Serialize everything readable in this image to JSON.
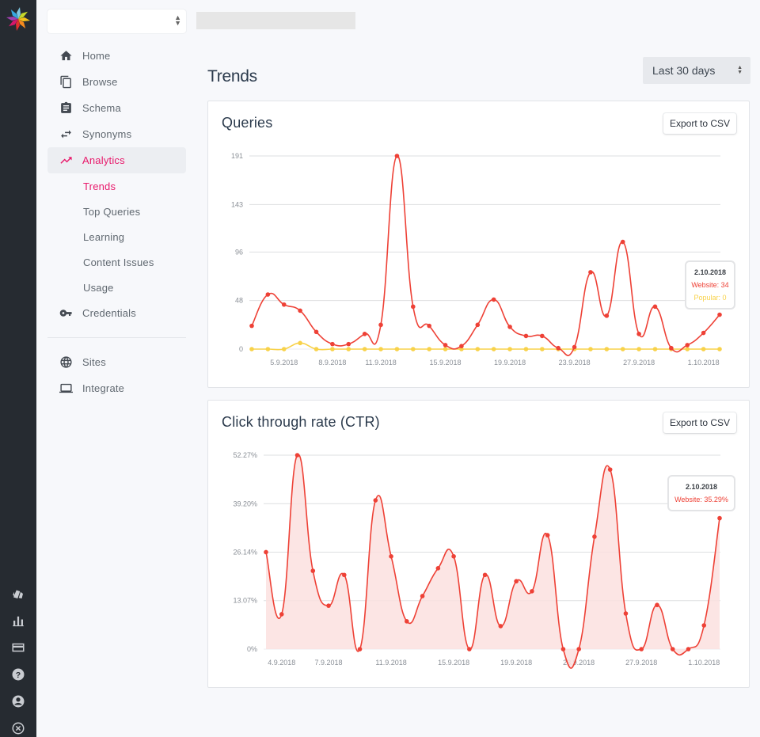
{
  "app": {
    "site_selector_value": "",
    "rail_icons": [
      "cards-icon",
      "bar-chart-icon",
      "credit-card-icon",
      "help-icon",
      "account-icon",
      "close-circle-icon"
    ]
  },
  "sidebar": {
    "items": [
      {
        "label": "Home",
        "icon": "home-icon"
      },
      {
        "label": "Browse",
        "icon": "copy-icon"
      },
      {
        "label": "Schema",
        "icon": "clipboard-icon"
      },
      {
        "label": "Synonyms",
        "icon": "swap-icon"
      },
      {
        "label": "Analytics",
        "icon": "trending-up-icon",
        "active": true
      }
    ],
    "analytics_sub": [
      {
        "label": "Trends",
        "active": true
      },
      {
        "label": "Top Queries"
      },
      {
        "label": "Learning"
      },
      {
        "label": "Content Issues"
      },
      {
        "label": "Usage"
      }
    ],
    "credentials": {
      "label": "Credentials",
      "icon": "key-icon"
    },
    "bottom_items": [
      {
        "label": "Sites",
        "icon": "globe-icon"
      },
      {
        "label": "Integrate",
        "icon": "laptop-icon"
      }
    ]
  },
  "header": {
    "title": "Trends",
    "range_select": "Last 30 days"
  },
  "colors": {
    "accent": "#e8196b",
    "website_series": "#ee4136",
    "popular_series": "#f8d24a",
    "ctr_fill": "#fbe0df"
  },
  "chart_data": [
    {
      "type": "line",
      "title": "Queries",
      "export_label": "Export to CSV",
      "xlabel": "",
      "ylabel": "",
      "yticks": [
        0,
        48,
        96,
        143,
        191
      ],
      "ylim": [
        0,
        191
      ],
      "grid": true,
      "x": [
        "3.9.2018",
        "4.9.2018",
        "5.9.2018",
        "6.9.2018",
        "7.9.2018",
        "8.9.2018",
        "9.9.2018",
        "10.9.2018",
        "11.9.2018",
        "12.9.2018",
        "13.9.2018",
        "14.9.2018",
        "15.9.2018",
        "16.9.2018",
        "17.9.2018",
        "18.9.2018",
        "19.9.2018",
        "20.9.2018",
        "21.9.2018",
        "22.9.2018",
        "23.9.2018",
        "24.9.2018",
        "25.9.2018",
        "26.9.2018",
        "27.9.2018",
        "28.9.2018",
        "29.9.2018",
        "30.9.2018",
        "1.10.2018",
        "2.10.2018"
      ],
      "xtick_labels": [
        "5.9.2018",
        "8.9.2018",
        "11.9.2018",
        "15.9.2018",
        "19.9.2018",
        "23.9.2018",
        "27.9.2018",
        "1.10.2018"
      ],
      "xtick_indices": [
        2,
        5,
        8,
        12,
        16,
        20,
        24,
        28
      ],
      "series": [
        {
          "name": "Website",
          "color": "#ee4136",
          "values": [
            23,
            54,
            44,
            38,
            17,
            5,
            5,
            15,
            24,
            191,
            42,
            23,
            4,
            3,
            24,
            49,
            22,
            13,
            13,
            1,
            2,
            76,
            33,
            106,
            15,
            42,
            1,
            4,
            16,
            34
          ]
        },
        {
          "name": "Popular",
          "color": "#f8d24a",
          "values": [
            0,
            0,
            0,
            6,
            0,
            0,
            0,
            0,
            0,
            0,
            0,
            0,
            0,
            0,
            0,
            0,
            0,
            0,
            0,
            0,
            0,
            0,
            0,
            0,
            0,
            0,
            0,
            0,
            0,
            0
          ]
        }
      ],
      "tooltip": {
        "date": "2.10.2018",
        "lines": [
          "Website: 34",
          "Popular: 0"
        ]
      }
    },
    {
      "type": "area",
      "title": "Click through rate (CTR)",
      "export_label": "Export to CSV",
      "xlabel": "",
      "ylabel": "",
      "yticks": [
        "0%",
        "13.07%",
        "26.14%",
        "39.20%",
        "52.27%"
      ],
      "ytick_values": [
        0,
        13.07,
        26.14,
        39.2,
        52.27
      ],
      "ylim": [
        0,
        52.27
      ],
      "grid": true,
      "x": [
        "3.9.2018",
        "4.9.2018",
        "5.9.2018",
        "6.9.2018",
        "7.9.2018",
        "8.9.2018",
        "9.9.2018",
        "10.9.2018",
        "11.9.2018",
        "12.9.2018",
        "13.9.2018",
        "14.9.2018",
        "15.9.2018",
        "16.9.2018",
        "17.9.2018",
        "18.9.2018",
        "19.9.2018",
        "20.9.2018",
        "21.9.2018",
        "22.9.2018",
        "23.9.2018",
        "24.9.2018",
        "25.9.2018",
        "26.9.2018",
        "27.9.2018",
        "28.9.2018",
        "29.9.2018",
        "30.9.2018",
        "1.10.2018",
        "2.10.2018"
      ],
      "xtick_labels": [
        "4.9.2018",
        "7.9.2018",
        "11.9.2018",
        "15.9.2018",
        "19.9.2018",
        "23.9.2018",
        "27.9.2018",
        "1.10.2018"
      ],
      "xtick_indices": [
        1,
        4,
        8,
        12,
        16,
        20,
        24,
        28
      ],
      "series": [
        {
          "name": "Website",
          "color": "#ee4136",
          "values": [
            26.14,
            9.4,
            52.27,
            21.1,
            11.7,
            20.0,
            0,
            40.1,
            25.0,
            7.5,
            14.3,
            21.8,
            25.0,
            0,
            20.0,
            6.2,
            18.3,
            15.6,
            30.7,
            0,
            0,
            30.3,
            48.4,
            9.6,
            0,
            11.9,
            0,
            0,
            6.4,
            35.29
          ]
        }
      ],
      "tooltip": {
        "date": "2.10.2018",
        "lines": [
          "Website: 35.29%"
        ]
      }
    }
  ]
}
